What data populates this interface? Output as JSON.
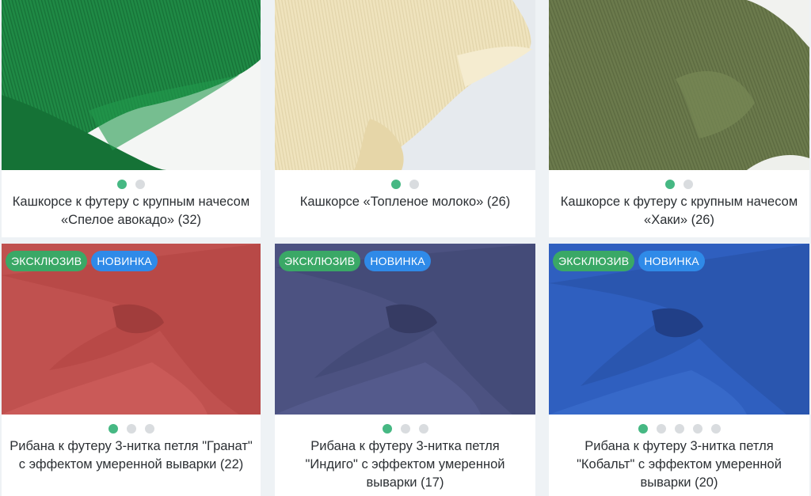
{
  "products": [
    {
      "title": "Кашкорсе к футеру с крупным начесом «Спелое авокадо» (32)",
      "image": "fabric-photo-green-rib",
      "color": "#1f8a45",
      "badges": [],
      "dots": 2,
      "active_dot": 0
    },
    {
      "title": "Кашкорсе «Топленое молоко» (26)",
      "image": "fabric-photo-cream-rib",
      "color": "#efe3bd",
      "badges": [],
      "dots": 2,
      "active_dot": 0
    },
    {
      "title": "Кашкорсе к футеру с крупным начесом «Хаки» (26)",
      "image": "fabric-photo-khaki-rib",
      "color": "#6b7a4c",
      "badges": [],
      "dots": 2,
      "active_dot": 0
    },
    {
      "title": "Рибана к футеру 3-нитка петля \"Гранат\" с эффектом умеренной выварки (22)",
      "image": "fabric-photo-garnet-melange",
      "color": "#c0514f",
      "badges": [
        "ЭКСКЛЮЗИВ",
        "НОВИНКА"
      ],
      "dots": 3,
      "active_dot": 0
    },
    {
      "title": "Рибана к футеру 3-нитка петля \"Индиго\" с эффектом умеренной выварки (17)",
      "image": "fabric-photo-indigo-melange",
      "color": "#4c5281",
      "badges": [
        "ЭКСКЛЮЗИВ",
        "НОВИНКА"
      ],
      "dots": 3,
      "active_dot": 0
    },
    {
      "title": "Рибана к футеру 3-нитка петля \"Кобальт\" с эффектом умеренной выварки (20)",
      "image": "fabric-photo-cobalt-melange",
      "color": "#2f5fbf",
      "badges": [
        "ЭКСКЛЮЗИВ",
        "НОВИНКА"
      ],
      "dots": 5,
      "active_dot": 0
    }
  ]
}
